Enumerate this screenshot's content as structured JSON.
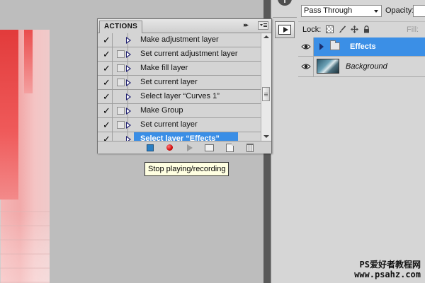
{
  "layers_panel": {
    "blend_mode": "Pass Through",
    "opacity_label": "Opacity:",
    "lock_label": "Lock:",
    "fill_label": "Fill:",
    "layers": [
      {
        "name": "Effects",
        "type": "group",
        "selected": true
      },
      {
        "name": "Background",
        "type": "layer",
        "selected": false
      }
    ]
  },
  "actions_panel": {
    "title": "ACTIONS",
    "collapse_glyph": "▸▸",
    "rows": [
      {
        "label": "Make adjustment layer",
        "checked": true,
        "dialog": false
      },
      {
        "label": "Set current adjustment layer",
        "checked": true,
        "dialog": false
      },
      {
        "label": "Make fill layer",
        "checked": true,
        "dialog": false
      },
      {
        "label": "Set current layer",
        "checked": true,
        "dialog": false
      },
      {
        "label": "Select layer “Curves 1”",
        "checked": true,
        "dialog": false
      },
      {
        "label": "Make Group",
        "checked": true,
        "dialog": false
      },
      {
        "label": "Set current layer",
        "checked": true,
        "dialog": false
      },
      {
        "label": "Select layer “Effects”",
        "checked": true,
        "dialog": false,
        "selected": true
      }
    ],
    "toolbar": [
      "stop-icon",
      "record-icon",
      "play-icon",
      "new-set-icon",
      "new-action-icon",
      "delete-icon"
    ]
  },
  "tooltip": {
    "text": "Stop playing/recording"
  },
  "dock": {
    "info_glyph": "i"
  },
  "watermark": {
    "line1": "PS爱好者教程网",
    "line2": "www.psahz.com"
  },
  "colors": {
    "selection": "#3a8ee6",
    "tooltip_bg": "#ffffe1",
    "record": "#d10b0b"
  }
}
